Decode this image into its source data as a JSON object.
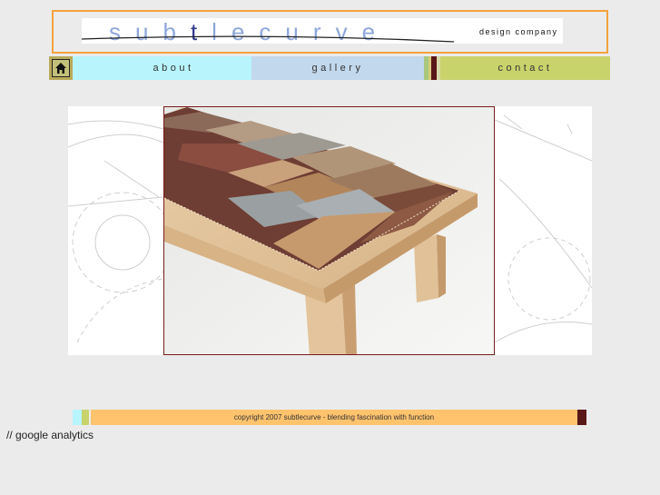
{
  "header": {
    "logo_word": "subtlecurve",
    "logo_tagline": "design company"
  },
  "nav": {
    "home_icon": "home-icon",
    "items": [
      {
        "label": "about"
      },
      {
        "label": "gallery"
      },
      {
        "label": "contact"
      }
    ]
  },
  "footer": {
    "copyright": "copyright 2007 subtlecurve - blending fascination with function"
  },
  "analytics_comment": "// google analytics",
  "colors": {
    "banner_border": "#f4a23c",
    "about_bg": "#b8f4fc",
    "gallery_bg": "#c2d8ec",
    "contact_bg": "#c9d36c",
    "footer_bg": "#ffc36e",
    "accent_dark": "#5a1717"
  }
}
